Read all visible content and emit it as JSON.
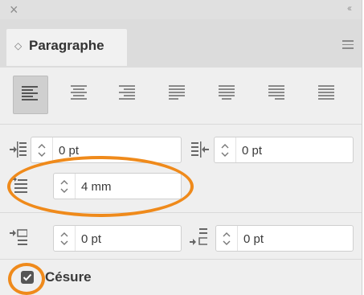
{
  "panel": {
    "close_glyph": "×",
    "collapse_glyph": "‹‹",
    "tab_label": "Paragraphe",
    "tab_icon": "◇"
  },
  "alignment": {
    "buttons": [
      {
        "name": "align-left",
        "active": true
      },
      {
        "name": "align-center",
        "active": false
      },
      {
        "name": "align-right",
        "active": false
      },
      {
        "name": "justify-last-left",
        "active": false
      },
      {
        "name": "justify-last-center",
        "active": false
      },
      {
        "name": "justify-last-right",
        "active": false
      },
      {
        "name": "justify-all",
        "active": false
      }
    ]
  },
  "fields": {
    "left_indent": "0 pt",
    "right_indent": "0 pt",
    "first_line_indent": "4 mm",
    "space_before": "0 pt",
    "space_after": "0 pt"
  },
  "hyphenation": {
    "label": "Césure",
    "checked": true
  },
  "colors": {
    "annotation": "#ef8a1b",
    "panel_bg": "#efefef"
  }
}
